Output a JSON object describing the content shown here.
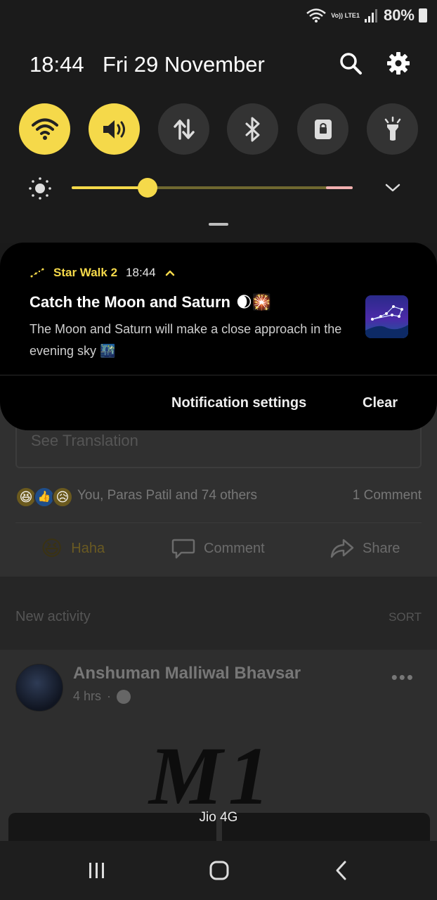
{
  "status_bar": {
    "battery": "80%",
    "network_label": "Vo)) LTE1"
  },
  "quick_panel": {
    "time": "18:44",
    "date": "Fri 29 November",
    "toggles": [
      {
        "name": "wifi",
        "on": true
      },
      {
        "name": "sound",
        "on": true
      },
      {
        "name": "mobile-data",
        "on": false
      },
      {
        "name": "bluetooth",
        "on": false
      },
      {
        "name": "screen-lock",
        "on": false
      },
      {
        "name": "flashlight",
        "on": false
      }
    ],
    "brightness_fraction": 0.27,
    "accent_color": "#f5d94a"
  },
  "notification": {
    "app_name": "Star Walk 2",
    "time": "18:44",
    "title": "Catch the Moon and Saturn",
    "title_emoji": "🌒🎇",
    "body": "The Moon and Saturn will make a close approach in the evening sky",
    "body_emoji": "🌃",
    "actions": {
      "settings": "Notification settings",
      "clear": "Clear"
    }
  },
  "feed": {
    "see_translation": "See Translation",
    "reactions_text": "You, Paras Patil and 74 others",
    "comments_count": "1 Comment",
    "actions": {
      "haha": "Haha",
      "comment": "Comment",
      "share": "Share"
    },
    "new_activity": "New activity",
    "sort": "SORT",
    "post": {
      "author": "Anshuman Malliwal Bhavsar",
      "time": "4 hrs",
      "image_text": "M1"
    }
  },
  "carrier": "Jio 4G"
}
